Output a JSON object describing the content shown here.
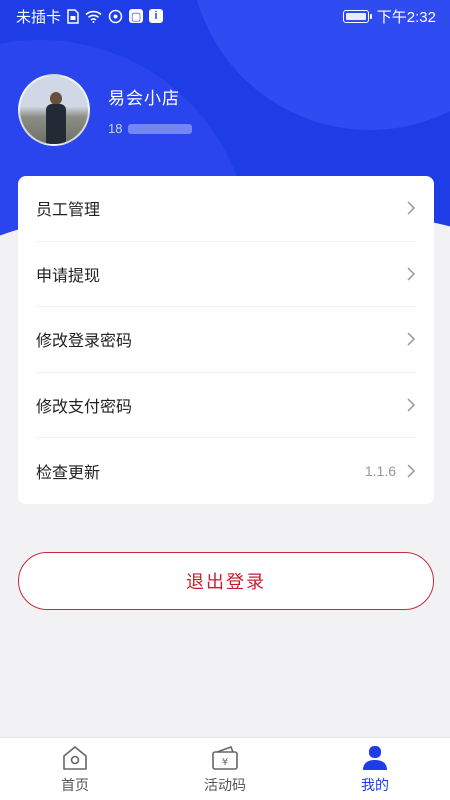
{
  "status_bar": {
    "carrier": "未插卡",
    "time": "下午2:32",
    "icons": [
      "sim-icon",
      "wifi-icon",
      "hotspot-icon",
      "app-notification-icon",
      "info-icon",
      "battery-icon"
    ]
  },
  "profile": {
    "shop_name": "易会小店",
    "phone_prefix": "18"
  },
  "menu": {
    "items": [
      {
        "label": "员工管理"
      },
      {
        "label": "申请提现"
      },
      {
        "label": "修改登录密码"
      },
      {
        "label": "修改支付密码"
      },
      {
        "label": "检查更新",
        "value": "1.1.6"
      }
    ]
  },
  "logout_label": "退出登录",
  "tabbar": {
    "tabs": [
      {
        "label": "首页",
        "icon": "home-icon"
      },
      {
        "label": "活动码",
        "icon": "voucher-icon"
      },
      {
        "label": "我的",
        "icon": "user-icon",
        "active": true
      }
    ]
  },
  "colors": {
    "primary": "#1f3de6",
    "danger": "#c41f30",
    "background": "#f2f2f4"
  }
}
